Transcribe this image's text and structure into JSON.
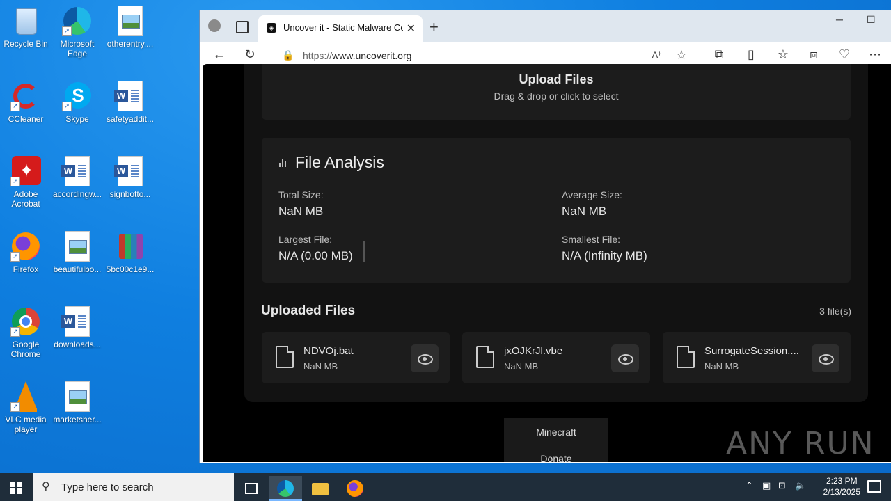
{
  "desktop": {
    "icons": [
      {
        "label": "Recycle Bin",
        "icon": "recycle-bin-icon"
      },
      {
        "label": "Microsoft Edge",
        "icon": "edge-icon"
      },
      {
        "label": "otherentry....",
        "icon": "image-file-icon"
      },
      {
        "label": "CCleaner",
        "icon": "ccleaner-icon"
      },
      {
        "label": "Skype",
        "icon": "skype-icon"
      },
      {
        "label": "safetyaddit...",
        "icon": "word-file-icon"
      },
      {
        "label": "Adobe Acrobat",
        "icon": "acrobat-icon"
      },
      {
        "label": "accordingw...",
        "icon": "word-file-icon"
      },
      {
        "label": "signbotto...",
        "icon": "word-file-icon"
      },
      {
        "label": "Firefox",
        "icon": "firefox-icon"
      },
      {
        "label": "beautifulbo...",
        "icon": "image-file-icon"
      },
      {
        "label": "5bc00c1e9...",
        "icon": "winrar-icon"
      },
      {
        "label": "Google Chrome",
        "icon": "chrome-icon"
      },
      {
        "label": "downloads...",
        "icon": "word-file-icon"
      },
      {
        "label": "VLC media player",
        "icon": "vlc-icon"
      },
      {
        "label": "marketsher...",
        "icon": "image-file-icon"
      }
    ]
  },
  "browser": {
    "tab_title": "Uncover it - Static Malware Confi",
    "url_prefix": "https://",
    "url_domain": "www.uncoverit.org",
    "new_tab": "+",
    "close_tab": "✕"
  },
  "page": {
    "upload_title": "Upload Files",
    "upload_sub": "Drag & drop or click to select",
    "analysis_title": "File Analysis",
    "stats": {
      "total_label": "Total Size:",
      "total_value": "NaN MB",
      "avg_label": "Average Size:",
      "avg_value": "NaN MB",
      "largest_label": "Largest File:",
      "largest_value": "N/A (0.00 MB)",
      "smallest_label": "Smallest File:",
      "smallest_value": "N/A (Infinity MB)"
    },
    "files_heading": "Uploaded Files",
    "files_count": "3 file(s)",
    "files": [
      {
        "name": "NDVOj.bat",
        "size": "NaN MB"
      },
      {
        "name": "jxOJKrJl.vbe",
        "size": "NaN MB"
      },
      {
        "name": "SurrogateSession....",
        "size": "NaN MB"
      }
    ],
    "menu": [
      "Minecraft",
      "Donate"
    ],
    "watermark": "ANY RUN"
  },
  "taskbar": {
    "search_placeholder": "Type here to search",
    "time": "2:23 PM",
    "date": "2/13/2025"
  }
}
